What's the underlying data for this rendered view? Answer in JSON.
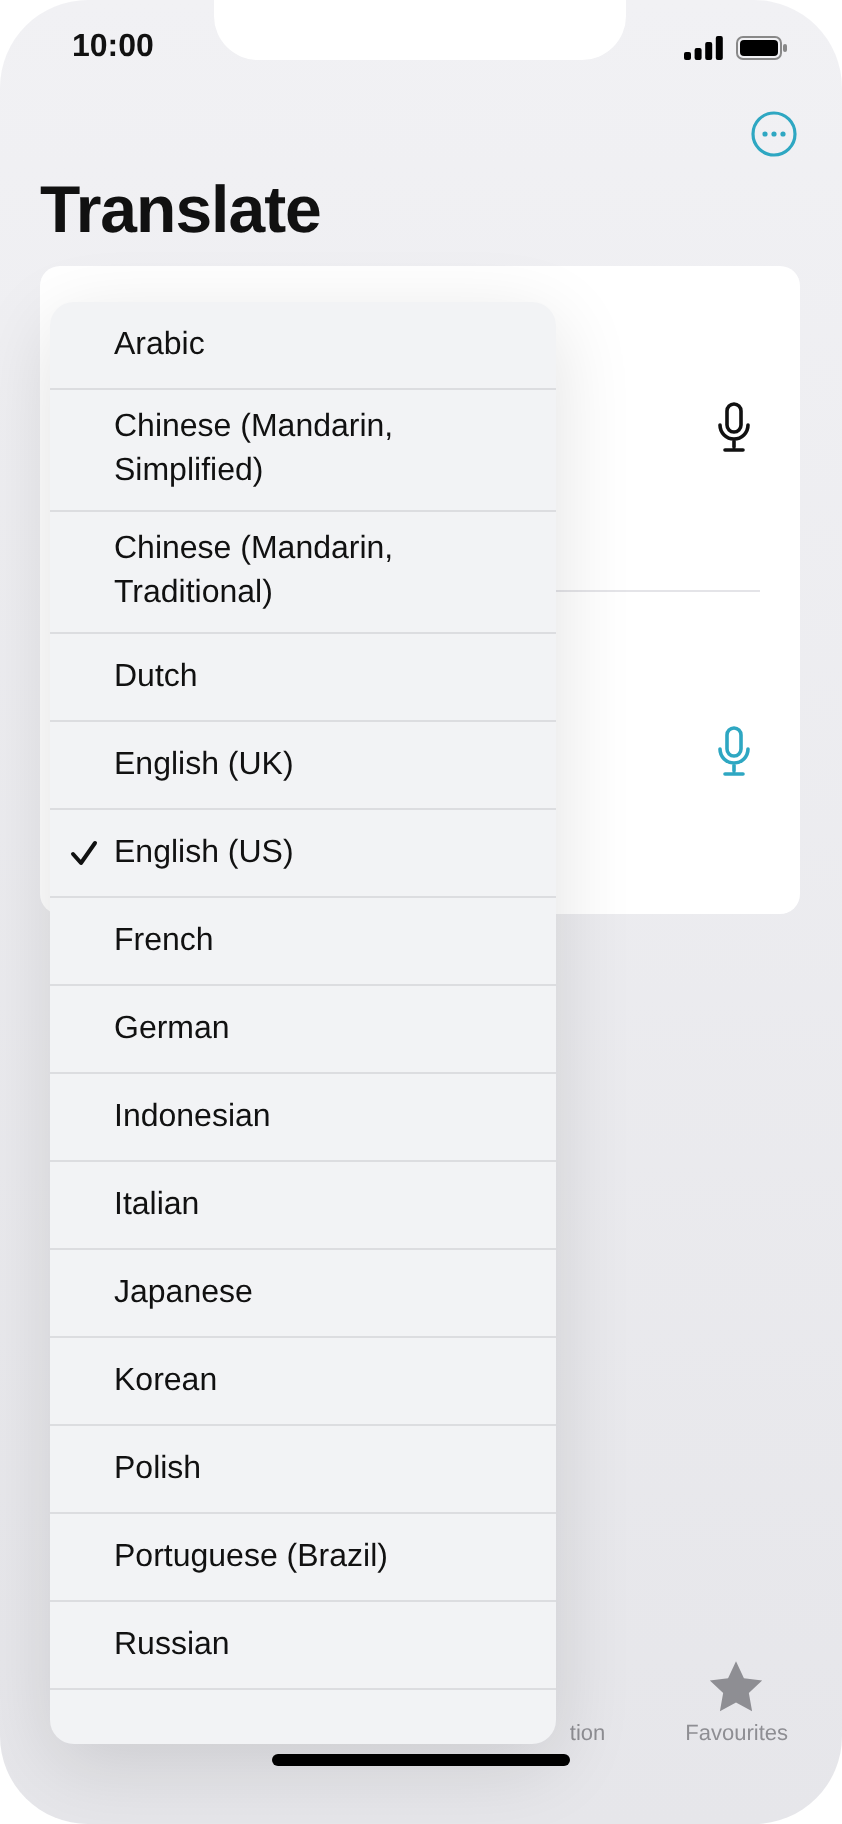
{
  "status_bar": {
    "time": "10:00"
  },
  "title": "Translate",
  "language_menu": [
    {
      "label": "Arabic",
      "selected": false
    },
    {
      "label": "Chinese (Mandarin, Simplified)",
      "selected": false
    },
    {
      "label": "Chinese (Mandarin, Traditional)",
      "selected": false
    },
    {
      "label": "Dutch",
      "selected": false
    },
    {
      "label": "English (UK)",
      "selected": false
    },
    {
      "label": "English (US)",
      "selected": true
    },
    {
      "label": "French",
      "selected": false
    },
    {
      "label": "German",
      "selected": false
    },
    {
      "label": "Indonesian",
      "selected": false
    },
    {
      "label": "Italian",
      "selected": false
    },
    {
      "label": "Japanese",
      "selected": false
    },
    {
      "label": "Korean",
      "selected": false
    },
    {
      "label": "Polish",
      "selected": false
    },
    {
      "label": "Portuguese (Brazil)",
      "selected": false
    },
    {
      "label": "Russian",
      "selected": false
    }
  ],
  "tab_bar": [
    {
      "label": "tion",
      "kind": "partial"
    },
    {
      "label": "Favourites",
      "kind": "favourites"
    }
  ]
}
